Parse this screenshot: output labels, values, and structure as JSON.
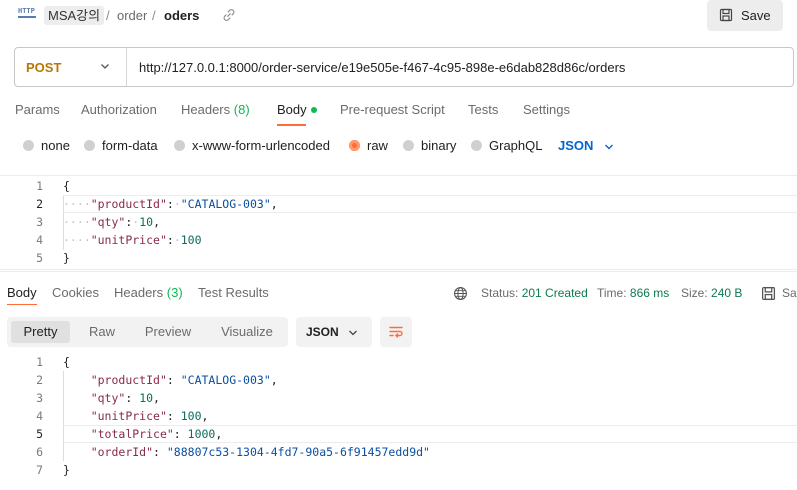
{
  "header": {
    "icon_label": "HTTP",
    "collection": "MSA강의",
    "folder": "order",
    "request_name": "oders",
    "separator": "/",
    "save_label": "Save"
  },
  "url_bar": {
    "method": "POST",
    "url": "http://127.0.0.1:8000/order-service/e19e505e-f467-4c95-898e-e6dab828d86c/orders"
  },
  "request_tabs": [
    {
      "label": "Params"
    },
    {
      "label": "Authorization"
    },
    {
      "label": "Headers",
      "count": "(8)"
    },
    {
      "label": "Body",
      "active": true
    },
    {
      "label": "Pre-request Script"
    },
    {
      "label": "Tests"
    },
    {
      "label": "Settings"
    }
  ],
  "body_types": [
    {
      "label": "none"
    },
    {
      "label": "form-data"
    },
    {
      "label": "x-www-form-urlencoded"
    },
    {
      "label": "raw",
      "selected": true
    },
    {
      "label": "binary"
    },
    {
      "label": "GraphQL"
    }
  ],
  "body_language": "JSON",
  "request_body": {
    "line_numbers": [
      "1",
      "2",
      "3",
      "4",
      "5"
    ],
    "lines": [
      {
        "text": "{"
      },
      {
        "key": "\"productId\"",
        "value": "\"CATALOG-003\"",
        "trail": ","
      },
      {
        "key": "\"qty\"",
        "value": "10",
        "trail": ","
      },
      {
        "key": "\"unitPrice\"",
        "value": "100",
        "trail": ""
      },
      {
        "text": "}"
      }
    ]
  },
  "response_tabs": [
    {
      "label": "Body",
      "active": true
    },
    {
      "label": "Cookies"
    },
    {
      "label": "Headers",
      "count": "(3)"
    },
    {
      "label": "Test Results"
    }
  ],
  "response_meta": {
    "status_label": "Status:",
    "status_value": "201 Created",
    "time_label": "Time:",
    "time_value": "866 ms",
    "size_label": "Size:",
    "size_value": "240 B",
    "save_label": "Sa"
  },
  "view_modes": [
    "Pretty",
    "Raw",
    "Preview",
    "Visualize"
  ],
  "response_format": "JSON",
  "response_body": {
    "line_numbers": [
      "1",
      "2",
      "3",
      "4",
      "5",
      "6",
      "7"
    ],
    "lines": [
      {
        "text": "{"
      },
      {
        "key": "\"productId\"",
        "value": "\"CATALOG-003\"",
        "trail": ","
      },
      {
        "key": "\"qty\"",
        "value": "10",
        "trail": ","
      },
      {
        "key": "\"unitPrice\"",
        "value": "100",
        "trail": ","
      },
      {
        "key": "\"totalPrice\"",
        "value": "1000",
        "trail": ","
      },
      {
        "key": "\"orderId\"",
        "value": "\"88807c53-1304-4fd7-90a5-6f91457edd9d\"",
        "trail": ""
      },
      {
        "text": "}"
      }
    ]
  },
  "colors": {
    "accent": "#ff6c37",
    "method_post": "#b7770b",
    "status_ok": "#0d7a4e",
    "link_blue": "#0265d2"
  }
}
